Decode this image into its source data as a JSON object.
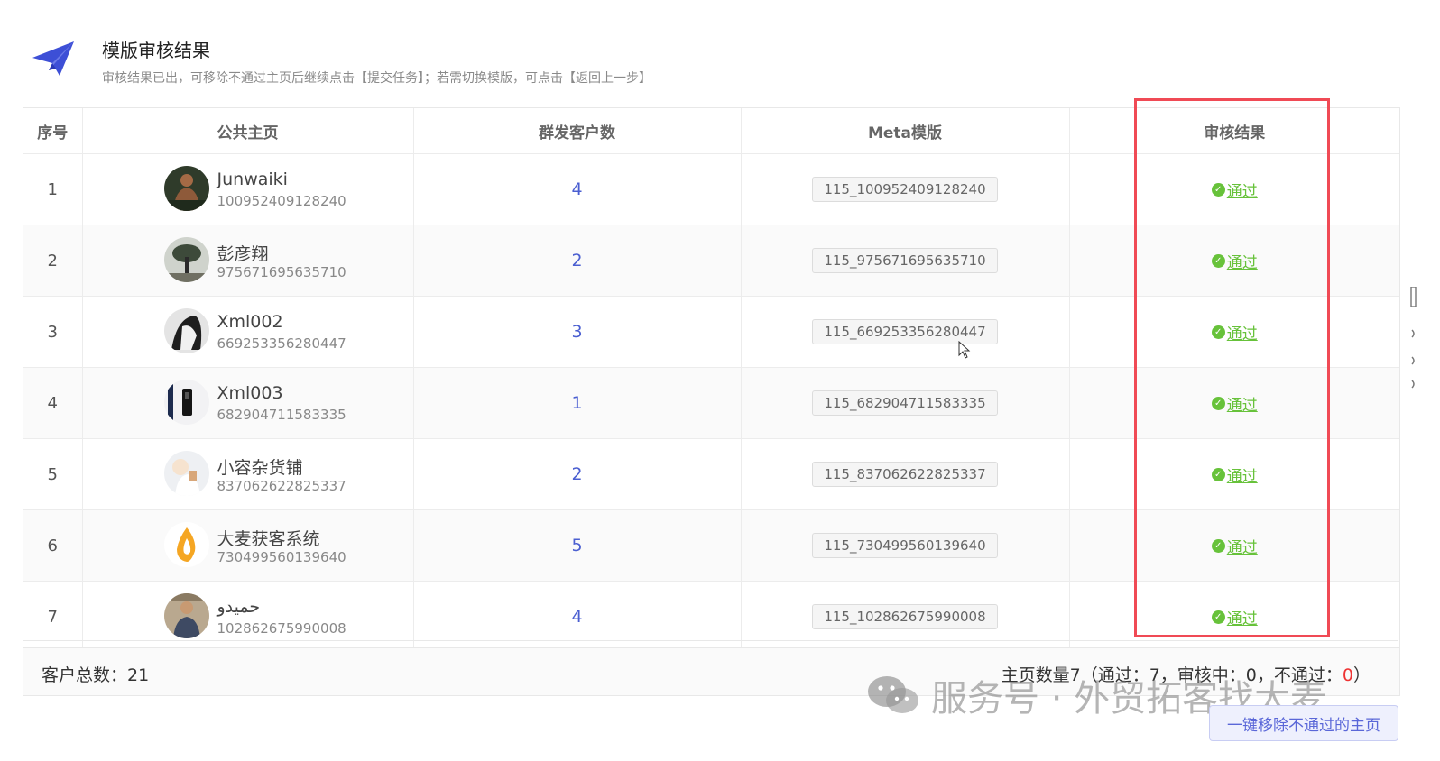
{
  "header": {
    "title": "模版审核结果",
    "description": "审核结果已出，可移除不通过主页后继续点击【提交任务】；若需切换模版，可点击【返回上一步】"
  },
  "table": {
    "columns": [
      "序号",
      "公共主页",
      "群发客户数",
      "Meta模版",
      "审核结果"
    ],
    "rows": [
      {
        "index": "1",
        "name": "Junwaiki",
        "page_id": "100952409128240",
        "count": "4",
        "template": "115_100952409128240",
        "result": "通过"
      },
      {
        "index": "2",
        "name": "彭彦翔",
        "page_id": "975671695635710",
        "count": "2",
        "template": "115_975671695635710",
        "result": "通过"
      },
      {
        "index": "3",
        "name": "Xml002",
        "page_id": "669253356280447",
        "count": "3",
        "template": "115_669253356280447",
        "result": "通过"
      },
      {
        "index": "4",
        "name": "Xml003",
        "page_id": "682904711583335",
        "count": "1",
        "template": "115_682904711583335",
        "result": "通过"
      },
      {
        "index": "5",
        "name": "小容杂货铺",
        "page_id": "837062622825337",
        "count": "2",
        "template": "115_837062622825337",
        "result": "通过"
      },
      {
        "index": "6",
        "name": "大麦获客系统",
        "page_id": "730499560139640",
        "count": "5",
        "template": "115_730499560139640",
        "result": "通过"
      },
      {
        "index": "7",
        "name": "حميدو",
        "page_id": "102862675990008",
        "count": "4",
        "template": "115_102862675990008",
        "result": "通过"
      }
    ]
  },
  "footer": {
    "total_label": "客户总数：",
    "total_value": "21",
    "stats_prefix": "主页数量7（通过：7，审核中：0，不通过：",
    "stats_fail": "0",
    "stats_suffix": "）"
  },
  "watermark": "服务号 · 外贸拓客找大麦",
  "remove_button": "一键移除不通过的主页",
  "colors": {
    "accent": "#4b5fd1",
    "pass": "#67c23a",
    "highlight_box": "#f04a55",
    "fail": "#ee3333"
  },
  "icons": {
    "logo": "paper-plane-icon",
    "result": "check-circle-icon",
    "watermark": "wechat-icon"
  }
}
